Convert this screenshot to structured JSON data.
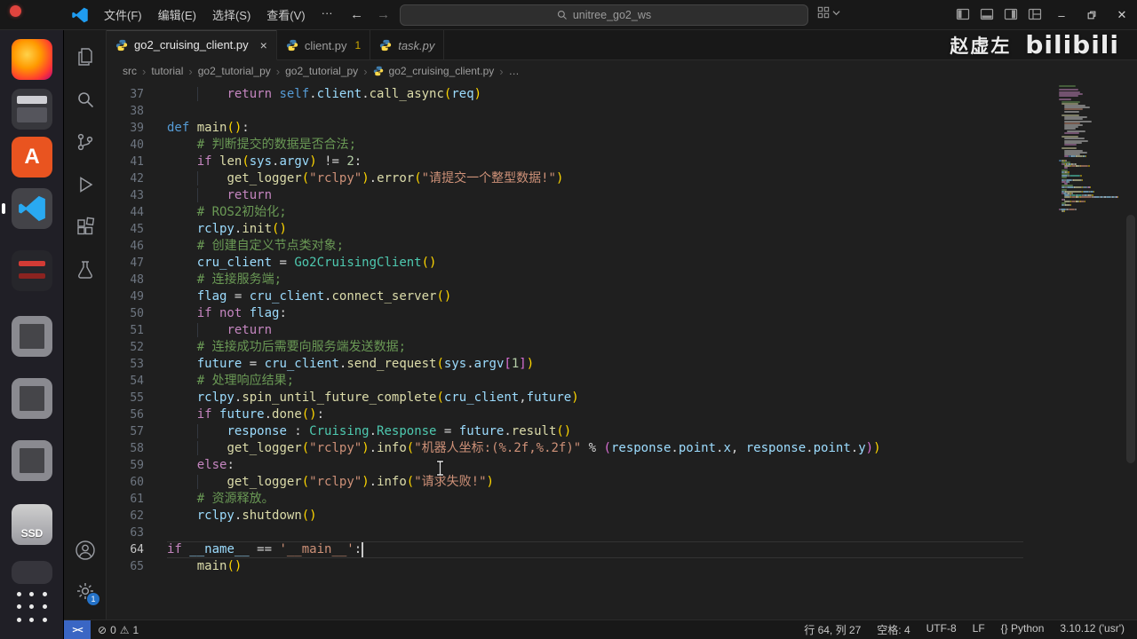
{
  "titlebar": {
    "menus": [
      "文件(F)",
      "编辑(E)",
      "选择(S)",
      "查看(V)",
      "···"
    ],
    "back": "←",
    "forward": "→",
    "search": "unitree_go2_ws",
    "controls": {
      "minimize": "–",
      "close": "✕"
    }
  },
  "watermark": {
    "author": "赵虚左",
    "brand": "bilibili"
  },
  "dock": {
    "app_center_letter": "A",
    "ssd_label": "SSD"
  },
  "tabs": [
    {
      "label": "go2_cruising_client.py",
      "close": "×"
    },
    {
      "label": "client.py",
      "badge": "1"
    },
    {
      "label": "task.py"
    }
  ],
  "breadcrumb": {
    "sep": "›",
    "items": [
      "src",
      "tutorial",
      "go2_tutorial_py",
      "go2_tutorial_py",
      "go2_cruising_client.py",
      "…"
    ]
  },
  "editor": {
    "current_line": 64,
    "cursor": {
      "line": 64,
      "col": 27
    },
    "lines": [
      {
        "n": 37,
        "t": [
          [
            "ws",
            "        "
          ],
          [
            "kw",
            "return "
          ],
          [
            "kb",
            "self"
          ],
          [
            "pl",
            "."
          ],
          [
            "va",
            "client"
          ],
          [
            "pl",
            "."
          ],
          [
            "fn",
            "call_async"
          ],
          [
            "p1",
            "("
          ],
          [
            "va",
            "req"
          ],
          [
            "p1",
            ")"
          ]
        ]
      },
      {
        "n": 38,
        "t": []
      },
      {
        "n": 39,
        "t": [
          [
            "kb",
            "def "
          ],
          [
            "fn",
            "main"
          ],
          [
            "p1",
            "()"
          ],
          [
            "pl",
            ":"
          ]
        ]
      },
      {
        "n": 40,
        "t": [
          [
            "ws",
            "    "
          ],
          [
            "co",
            "# 判断提交的数据是否合法;"
          ]
        ]
      },
      {
        "n": 41,
        "t": [
          [
            "ws",
            "    "
          ],
          [
            "kw",
            "if "
          ],
          [
            "fn",
            "len"
          ],
          [
            "p1",
            "("
          ],
          [
            "va",
            "sys"
          ],
          [
            "pl",
            "."
          ],
          [
            "va",
            "argv"
          ],
          [
            "p1",
            ")"
          ],
          [
            "pl",
            " != "
          ],
          [
            "nu",
            "2"
          ],
          [
            "pl",
            ":"
          ]
        ]
      },
      {
        "n": 42,
        "t": [
          [
            "ws",
            "        "
          ],
          [
            "fn",
            "get_logger"
          ],
          [
            "p1",
            "("
          ],
          [
            "st",
            "\"rclpy\""
          ],
          [
            "p1",
            ")"
          ],
          [
            "pl",
            "."
          ],
          [
            "fn",
            "error"
          ],
          [
            "p1",
            "("
          ],
          [
            "st",
            "\"请提交一个整型数据!\""
          ],
          [
            "p1",
            ")"
          ]
        ]
      },
      {
        "n": 43,
        "t": [
          [
            "ws",
            "        "
          ],
          [
            "kw",
            "return"
          ]
        ]
      },
      {
        "n": 44,
        "t": [
          [
            "ws",
            "    "
          ],
          [
            "co",
            "# ROS2初始化;"
          ]
        ]
      },
      {
        "n": 45,
        "t": [
          [
            "ws",
            "    "
          ],
          [
            "va",
            "rclpy"
          ],
          [
            "pl",
            "."
          ],
          [
            "fn",
            "init"
          ],
          [
            "p1",
            "()"
          ]
        ]
      },
      {
        "n": 46,
        "t": [
          [
            "ws",
            "    "
          ],
          [
            "co",
            "# 创建自定义节点类对象;"
          ]
        ]
      },
      {
        "n": 47,
        "t": [
          [
            "ws",
            "    "
          ],
          [
            "va",
            "cru_client"
          ],
          [
            "pl",
            " = "
          ],
          [
            "cl",
            "Go2CruisingClient"
          ],
          [
            "p1",
            "()"
          ]
        ]
      },
      {
        "n": 48,
        "t": [
          [
            "ws",
            "    "
          ],
          [
            "co",
            "# 连接服务端;"
          ]
        ]
      },
      {
        "n": 49,
        "t": [
          [
            "ws",
            "    "
          ],
          [
            "va",
            "flag"
          ],
          [
            "pl",
            " = "
          ],
          [
            "va",
            "cru_client"
          ],
          [
            "pl",
            "."
          ],
          [
            "fn",
            "connect_server"
          ],
          [
            "p1",
            "()"
          ]
        ]
      },
      {
        "n": 50,
        "t": [
          [
            "ws",
            "    "
          ],
          [
            "kw",
            "if not "
          ],
          [
            "va",
            "flag"
          ],
          [
            "pl",
            ":"
          ]
        ]
      },
      {
        "n": 51,
        "t": [
          [
            "ws",
            "        "
          ],
          [
            "kw",
            "return"
          ]
        ]
      },
      {
        "n": 52,
        "t": [
          [
            "ws",
            "    "
          ],
          [
            "co",
            "# 连接成功后需要向服务端发送数据;"
          ]
        ]
      },
      {
        "n": 53,
        "t": [
          [
            "ws",
            "    "
          ],
          [
            "va",
            "future"
          ],
          [
            "pl",
            " = "
          ],
          [
            "va",
            "cru_client"
          ],
          [
            "pl",
            "."
          ],
          [
            "fn",
            "send_request"
          ],
          [
            "p1",
            "("
          ],
          [
            "va",
            "sys"
          ],
          [
            "pl",
            "."
          ],
          [
            "va",
            "argv"
          ],
          [
            "p2",
            "["
          ],
          [
            "nu",
            "1"
          ],
          [
            "p2",
            "]"
          ],
          [
            "p1",
            ")"
          ]
        ]
      },
      {
        "n": 54,
        "t": [
          [
            "ws",
            "    "
          ],
          [
            "co",
            "# 处理响应结果;"
          ]
        ]
      },
      {
        "n": 55,
        "t": [
          [
            "ws",
            "    "
          ],
          [
            "va",
            "rclpy"
          ],
          [
            "pl",
            "."
          ],
          [
            "fn",
            "spin_until_future_complete"
          ],
          [
            "p1",
            "("
          ],
          [
            "va",
            "cru_client"
          ],
          [
            "pl",
            ","
          ],
          [
            "va",
            "future"
          ],
          [
            "p1",
            ")"
          ]
        ]
      },
      {
        "n": 56,
        "t": [
          [
            "ws",
            "    "
          ],
          [
            "kw",
            "if "
          ],
          [
            "va",
            "future"
          ],
          [
            "pl",
            "."
          ],
          [
            "fn",
            "done"
          ],
          [
            "p1",
            "()"
          ],
          [
            "pl",
            ":"
          ]
        ]
      },
      {
        "n": 57,
        "t": [
          [
            "ws",
            "        "
          ],
          [
            "va",
            "response"
          ],
          [
            "pl",
            " : "
          ],
          [
            "cl",
            "Cruising"
          ],
          [
            "pl",
            "."
          ],
          [
            "cl",
            "Response"
          ],
          [
            "pl",
            " = "
          ],
          [
            "va",
            "future"
          ],
          [
            "pl",
            "."
          ],
          [
            "fn",
            "result"
          ],
          [
            "p1",
            "()"
          ]
        ]
      },
      {
        "n": 58,
        "t": [
          [
            "ws",
            "        "
          ],
          [
            "fn",
            "get_logger"
          ],
          [
            "p1",
            "("
          ],
          [
            "st",
            "\"rclpy\""
          ],
          [
            "p1",
            ")"
          ],
          [
            "pl",
            "."
          ],
          [
            "fn",
            "info"
          ],
          [
            "p1",
            "("
          ],
          [
            "st",
            "\"机器人坐标:(%.2f,%.2f)\""
          ],
          [
            "pl",
            " % "
          ],
          [
            "p2",
            "("
          ],
          [
            "va",
            "response"
          ],
          [
            "pl",
            "."
          ],
          [
            "va",
            "point"
          ],
          [
            "pl",
            "."
          ],
          [
            "va",
            "x"
          ],
          [
            "pl",
            ", "
          ],
          [
            "va",
            "response"
          ],
          [
            "pl",
            "."
          ],
          [
            "va",
            "point"
          ],
          [
            "pl",
            "."
          ],
          [
            "va",
            "y"
          ],
          [
            "p2",
            ")"
          ],
          [
            "p1",
            ")"
          ]
        ]
      },
      {
        "n": 59,
        "t": [
          [
            "ws",
            "    "
          ],
          [
            "kw",
            "else"
          ],
          [
            "pl",
            ":"
          ]
        ]
      },
      {
        "n": 60,
        "t": [
          [
            "ws",
            "        "
          ],
          [
            "fn",
            "get_logger"
          ],
          [
            "p1",
            "("
          ],
          [
            "st",
            "\"rclpy\""
          ],
          [
            "p1",
            ")"
          ],
          [
            "pl",
            "."
          ],
          [
            "fn",
            "info"
          ],
          [
            "p1",
            "("
          ],
          [
            "st",
            "\"请求失败!\""
          ],
          [
            "p1",
            ")"
          ]
        ]
      },
      {
        "n": 61,
        "t": [
          [
            "ws",
            "    "
          ],
          [
            "co",
            "# 资源释放。"
          ]
        ]
      },
      {
        "n": 62,
        "t": [
          [
            "ws",
            "    "
          ],
          [
            "va",
            "rclpy"
          ],
          [
            "pl",
            "."
          ],
          [
            "fn",
            "shutdown"
          ],
          [
            "p1",
            "()"
          ]
        ]
      },
      {
        "n": 63,
        "t": []
      },
      {
        "n": 64,
        "t": [
          [
            "kw",
            "if "
          ],
          [
            "va",
            "__name__"
          ],
          [
            "pl",
            " == "
          ],
          [
            "st",
            "'__main__'"
          ],
          [
            "pl",
            ":"
          ]
        ]
      },
      {
        "n": 65,
        "t": [
          [
            "ws",
            "    "
          ],
          [
            "fn",
            "main"
          ],
          [
            "p1",
            "()"
          ]
        ]
      }
    ]
  },
  "statusbar": {
    "remote_glyph": "><",
    "error_icon": "⊘",
    "errors": "0",
    "warning_icon": "⚠",
    "warnings": "1",
    "right": [
      "行 64, 列 27",
      "空格: 4",
      "UTF-8",
      "LF",
      "{} Python",
      "3.10.12 ('usr')"
    ]
  }
}
